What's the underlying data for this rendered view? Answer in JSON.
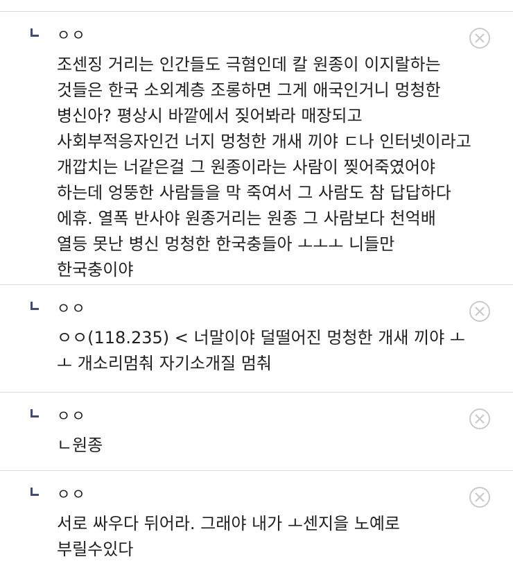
{
  "comments": [
    {
      "nick": "ㅇㅇ",
      "text": "조센징 거리는 인간들도 극혐인데 칼 원종이 이지랄하는 것들은 한국 소외계층 조롱하면 그게 애국인거니 멍청한 병신아? 평상시 바깥에서 짖어봐라 매장되고 사회부적응자인건 너지 멍청한 개새 끼야 ㄷ나 인터넷이라고 개깝치는 너같은걸 그 원종이라는 사람이 찢어죽였어야 하는데 엉뚱한 사람들을 막 죽여서 그 사람도 참 답답하다 에휴. 열폭 반사야 원종거리는 원종 그 사람보다 천억배 열등 못난 병신 멍청한 한국충들아 ㅗㅗㅗ 니들만 한국충이야"
    },
    {
      "nick": "ㅇㅇ",
      "text": "ㅇㅇ(118.235) < 너말이야 덜떨어진 멍청한 개새 끼야 ㅗ ㅗ 개소리멈춰 자기소개질 멈춰"
    },
    {
      "nick": "ㅇㅇ",
      "text": "ㄴ원종"
    },
    {
      "nick": "ㅇㅇ",
      "text": "서로 싸우다 뒤어라. 그래야 내가 ㅗ센지을 노예로 부릴수있다"
    }
  ],
  "icons": {
    "reply_arrow": "reply-corner-icon",
    "delete": "close-circle-icon"
  },
  "colors": {
    "reply_arrow": "#3b4a86",
    "delete_icon": "#c9c9d0",
    "divider": "#d9d9e0"
  }
}
